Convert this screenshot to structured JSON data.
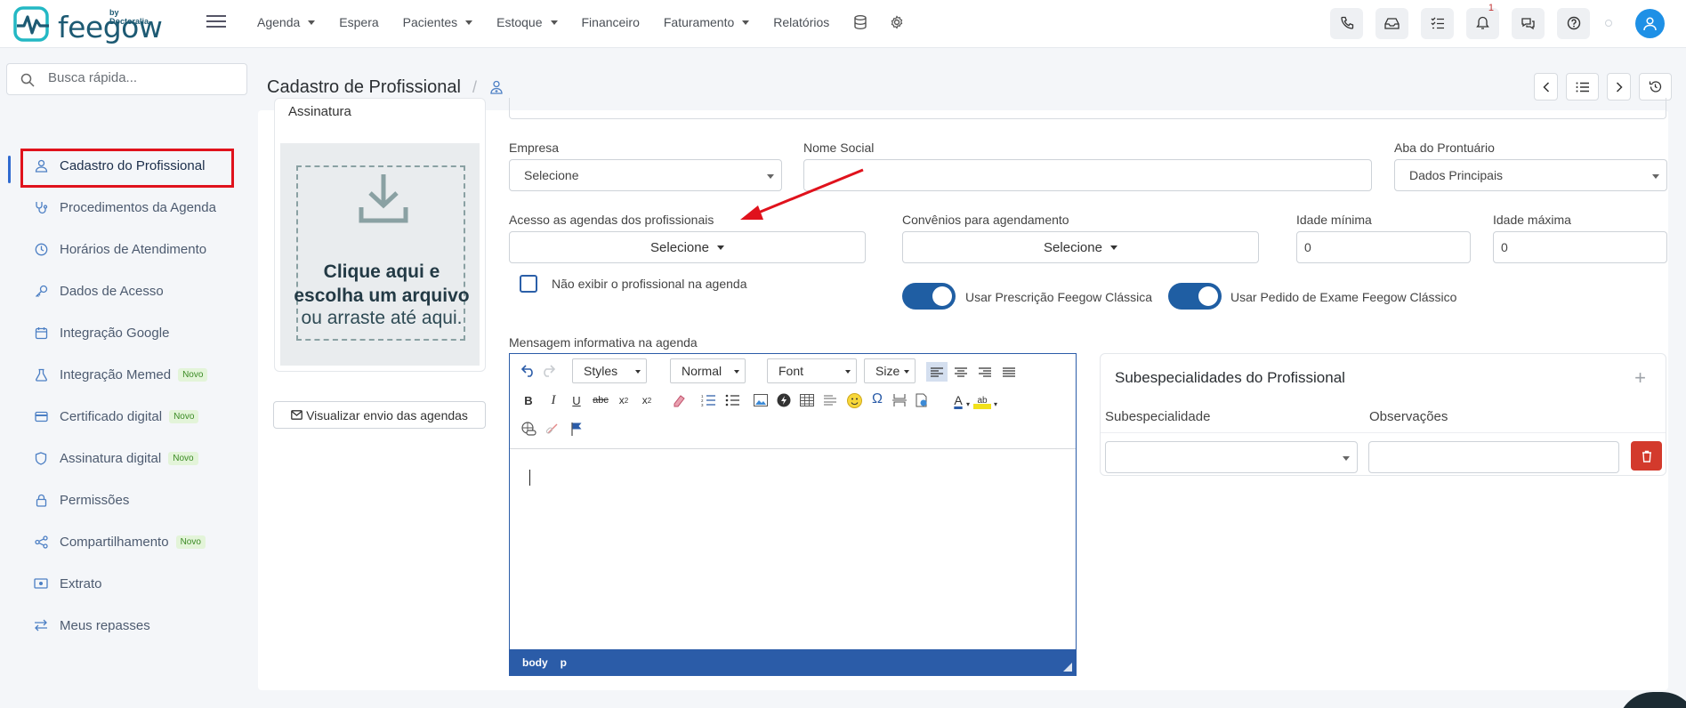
{
  "brand": {
    "name": "feegow",
    "sub": "by Doctoralia",
    "accent": "#1d5a73"
  },
  "nav": {
    "items": [
      {
        "label": "Agenda",
        "dropdown": true
      },
      {
        "label": "Espera",
        "dropdown": false
      },
      {
        "label": "Pacientes",
        "dropdown": true
      },
      {
        "label": "Estoque",
        "dropdown": true
      },
      {
        "label": "Financeiro",
        "dropdown": false
      },
      {
        "label": "Faturamento",
        "dropdown": true
      },
      {
        "label": "Relatórios",
        "dropdown": false
      }
    ],
    "icons": [
      "database-icon",
      "gear-icon"
    ]
  },
  "topbar": {
    "icons": [
      "phone-icon",
      "inbox-icon",
      "checklist-icon",
      "bell-icon",
      "chat-icon",
      "help-icon"
    ],
    "notification_count": "1"
  },
  "search": {
    "placeholder": "Busca rápida..."
  },
  "sidebar": {
    "items": [
      {
        "label": "Cadastro do Profissional",
        "icon": "user-icon",
        "badge": ""
      },
      {
        "label": "Procedimentos da Agenda",
        "icon": "stethoscope-icon",
        "badge": ""
      },
      {
        "label": "Horários de Atendimento",
        "icon": "clock-icon",
        "badge": ""
      },
      {
        "label": "Dados de Acesso",
        "icon": "key-icon",
        "badge": ""
      },
      {
        "label": "Integração Google",
        "icon": "calendar-icon",
        "badge": ""
      },
      {
        "label": "Integração Memed",
        "icon": "flask-icon",
        "badge": "Novo"
      },
      {
        "label": "Certificado digital",
        "icon": "card-icon",
        "badge": "Novo"
      },
      {
        "label": "Assinatura digital",
        "icon": "shield-icon",
        "badge": "Novo"
      },
      {
        "label": "Permissões",
        "icon": "lock-icon",
        "badge": ""
      },
      {
        "label": "Compartilhamento",
        "icon": "share-icon",
        "badge": "Novo"
      },
      {
        "label": "Extrato",
        "icon": "money-icon",
        "badge": ""
      },
      {
        "label": "Meus repasses",
        "icon": "transfer-icon",
        "badge": ""
      }
    ]
  },
  "page": {
    "title": "Cadastro de Profissional",
    "separator": "/"
  },
  "signature": {
    "title": "Assinatura",
    "drop_line1": "Clique aqui e",
    "drop_line2": "escolha um arquivo",
    "drop_line3": "ou arraste até aqui."
  },
  "visualize_button": "Visualizar envio das agendas",
  "form": {
    "empresa_label": "Empresa",
    "empresa_value": "Selecione",
    "nome_social_label": "Nome Social",
    "nome_social_value": "",
    "aba_label": "Aba do Prontuário",
    "aba_value": "Dados Principais",
    "acesso_label": "Acesso as agendas dos profissionais",
    "acesso_value": "Selecione",
    "convenios_label": "Convênios para agendamento",
    "convenios_value": "Selecione",
    "idade_min_label": "Idade mínima",
    "idade_min_value": "0",
    "idade_max_label": "Idade máxima",
    "idade_max_value": "0",
    "nao_exibir_label": "Não exibir o profissional na agenda",
    "prescricao_label": "Usar Prescrição Feegow Clássica",
    "pedido_label": "Usar Pedido de Exame Feegow Clássico",
    "mensagem_label": "Mensagem informativa na agenda"
  },
  "editor": {
    "styles": "Styles",
    "format": "Normal",
    "font": "Font",
    "size": "Size",
    "status_path": [
      "body",
      "p"
    ]
  },
  "subspecialties": {
    "title": "Subespecialidades do Profissional",
    "col_sub": "Subespecialidade",
    "col_obs": "Observações",
    "add": "+"
  },
  "colors": {
    "primary": "#1f5ea3",
    "highlight_box": "#e0121c",
    "annotation_arrow": "#e0121c",
    "danger": "#d33a2c",
    "novo_badge": "#3a8a24"
  }
}
